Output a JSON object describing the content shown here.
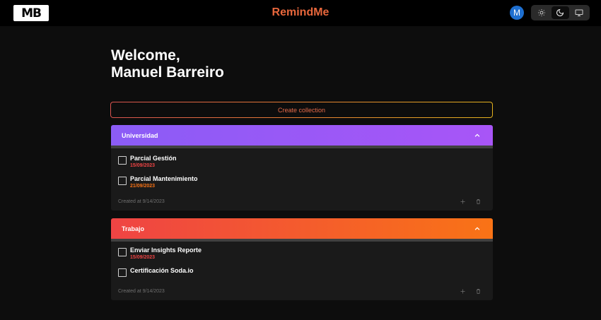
{
  "header": {
    "logo_text": "MB",
    "app_title": "RemindMe",
    "avatar_letter": "M",
    "theme_options": [
      "sun-icon",
      "moon-icon",
      "monitor-icon"
    ],
    "active_theme": "moon-icon"
  },
  "welcome": {
    "line1": "Welcome,",
    "line2": "Manuel Barreiro"
  },
  "create_collection_label": "Create collection",
  "collections": [
    {
      "title": "Universidad",
      "gradient": [
        "#8b5cf6",
        "#a855f7"
      ],
      "tasks": [
        {
          "name": "Parcial Gestión",
          "date": "15/09/2023",
          "date_color": "#ef4444",
          "done": false
        },
        {
          "name": "Parcial Mantenimiento",
          "date": "21/09/2023",
          "date_color": "#f97316",
          "done": false
        }
      ],
      "created": "Created at 9/14/2023"
    },
    {
      "title": "Trabajo",
      "gradient": [
        "#ef4444",
        "#f97316"
      ],
      "tasks": [
        {
          "name": "Enviar Insights Reporte",
          "date": "15/09/2023",
          "date_color": "#ef4444",
          "done": false
        },
        {
          "name": "Certificación Soda.io",
          "date": "",
          "date_color": "#f97316",
          "done": false
        }
      ],
      "created": "Created at 9/14/2023"
    }
  ]
}
